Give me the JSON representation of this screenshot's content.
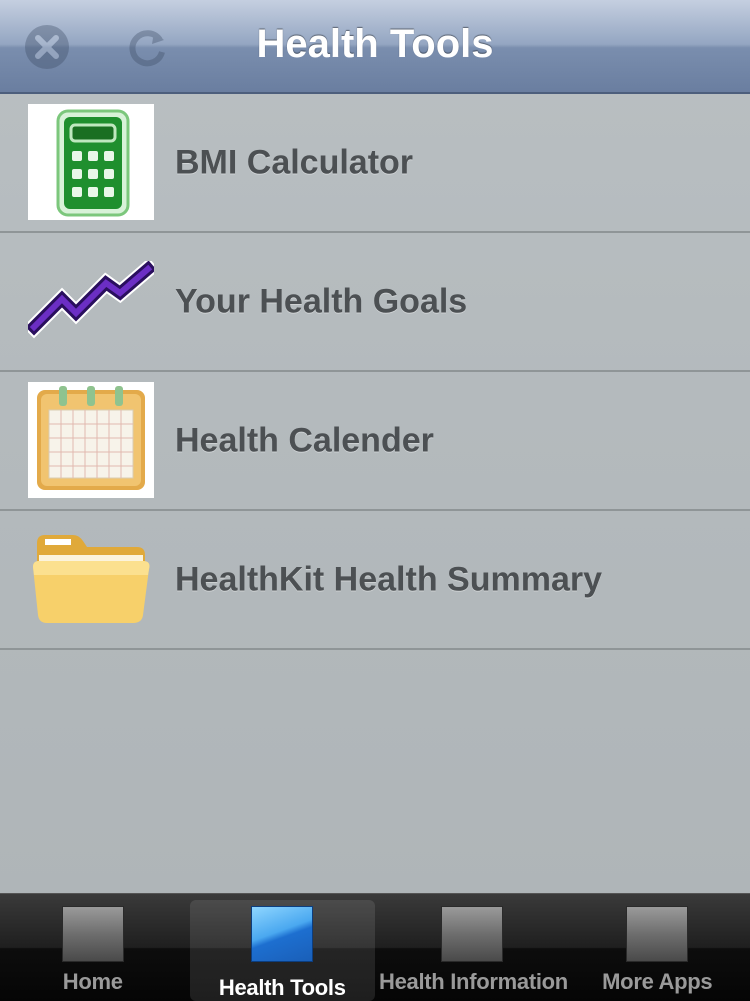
{
  "navbar": {
    "title": "Health Tools",
    "left_buttons": [
      {
        "icon": "close-icon"
      },
      {
        "icon": "refresh-icon"
      }
    ]
  },
  "list": {
    "items": [
      {
        "label": "BMI Calculator",
        "icon": "calculator-icon"
      },
      {
        "label": "Your Health Goals",
        "icon": "trend-line-icon"
      },
      {
        "label": "Health Calender",
        "icon": "calendar-icon"
      },
      {
        "label": "HealthKit Health Summary",
        "icon": "folder-icon"
      }
    ]
  },
  "tabbar": {
    "tabs": [
      {
        "label": "Home",
        "selected": false
      },
      {
        "label": "Health Tools",
        "selected": true
      },
      {
        "label": "Health Information",
        "selected": false
      },
      {
        "label": "More Apps",
        "selected": false
      }
    ]
  },
  "colors": {
    "navbar_blue": "#7a8eae",
    "list_background": "#b4babd",
    "label_text": "#4c5053",
    "calculator_green": "#1f8f2e",
    "goals_purple": "#5a1fa8",
    "folder_yellow": "#f2c75a",
    "selected_tab_blue": "#4aa8f0"
  }
}
